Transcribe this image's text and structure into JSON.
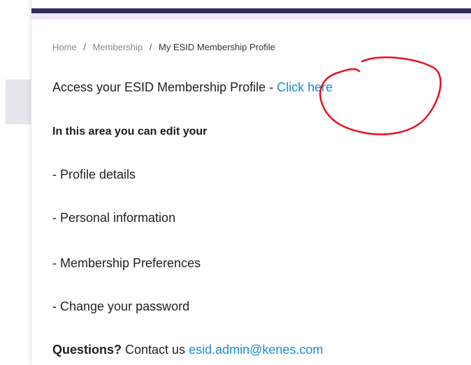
{
  "breadcrumb": {
    "items": [
      "Home",
      "Membership",
      "My ESID Membership Profile"
    ],
    "separator": "/"
  },
  "access": {
    "text": "Access your ESID Membership Profile - ",
    "link_label": "Click here"
  },
  "intro": "In this area you can edit your",
  "features": [
    "- Profile details",
    "- Personal information",
    "- Membership Preferences",
    "- Change your password"
  ],
  "contact": {
    "label": "Questions?",
    "text": " Contact us ",
    "email": "esid.admin@kenes.com"
  },
  "colors": {
    "top_bar": "#2e2c5f",
    "link": "#1b8bd4",
    "annotation": "#e8101c"
  }
}
